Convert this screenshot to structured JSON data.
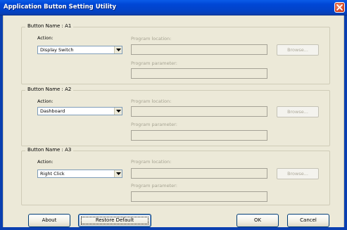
{
  "window": {
    "title": "Application Button Setting Utility"
  },
  "groups": [
    {
      "legend": "Button Name : A1",
      "action_label": "Action:",
      "action_value": "Display Switch",
      "program_location_label": "Program location:",
      "program_location_value": "",
      "program_parameter_label": "Program parameter:",
      "program_parameter_value": "",
      "browse_label": "Browse..."
    },
    {
      "legend": "Button Name : A2",
      "action_label": "Action:",
      "action_value": "Dashboard",
      "program_location_label": "Program location:",
      "program_location_value": "",
      "program_parameter_label": "Program parameter:",
      "program_parameter_value": "",
      "browse_label": "Browse..."
    },
    {
      "legend": "Button Name : A3",
      "action_label": "Action:",
      "action_value": "Right Click",
      "program_location_label": "Program location:",
      "program_location_value": "",
      "program_parameter_label": "Program parameter:",
      "program_parameter_value": "",
      "browse_label": "Browse..."
    }
  ],
  "buttons": {
    "about": "About",
    "restore_default": "Restore Default",
    "ok": "OK",
    "cancel": "Cancel"
  },
  "icons": {
    "close": "close-icon",
    "dropdown": "chevron-down-icon"
  },
  "colors": {
    "titlebar": "#0046d5",
    "close": "#d0401e",
    "dialog_bg": "#ece9d8",
    "disabled_text": "#a6a392"
  }
}
